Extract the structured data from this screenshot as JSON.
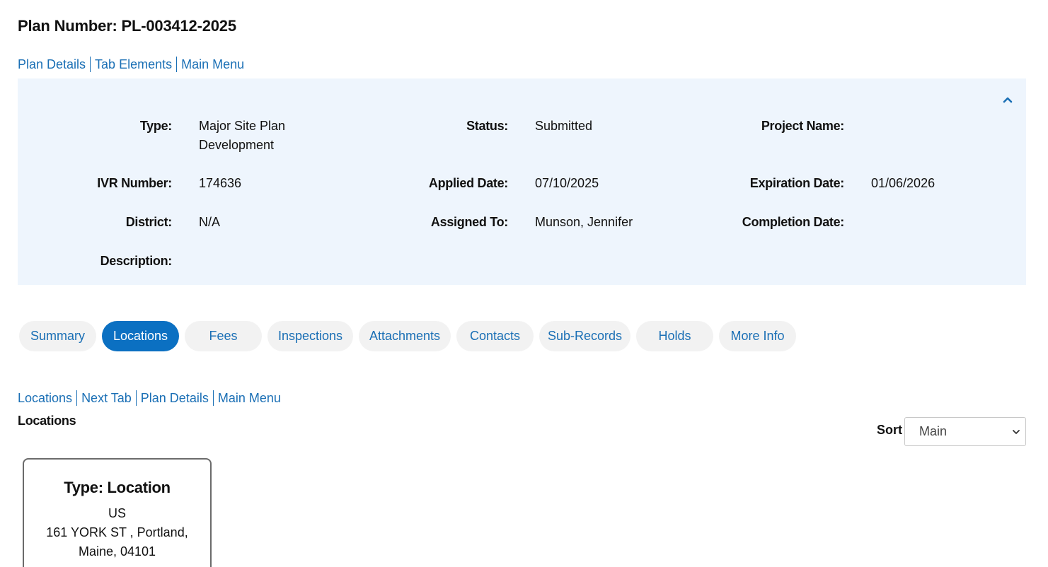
{
  "plan_title": "Plan Number: PL-003412-2025",
  "top_nav": [
    "Plan Details",
    "Tab Elements",
    "Main Menu"
  ],
  "details": {
    "type_label": "Type:",
    "type_value": [
      "Major Site Plan",
      "Development"
    ],
    "status_label": "Status:",
    "status_value": "Submitted",
    "project_name_label": "Project Name:",
    "project_name_value": "",
    "ivr_label": "IVR Number:",
    "ivr_value": "174636",
    "applied_label": "Applied Date:",
    "applied_value": "07/10/2025",
    "expiration_label": "Expiration Date:",
    "expiration_value": "01/06/2026",
    "district_label": "District:",
    "district_value": "N/A",
    "assigned_label": "Assigned To:",
    "assigned_value": "Munson, Jennifer",
    "completion_label": "Completion Date:",
    "completion_value": "",
    "description_label": "Description:",
    "description_value": "",
    "collapse_icon": "chevron-up-icon"
  },
  "tabs": [
    "Summary",
    "Locations",
    "Fees",
    "Inspections",
    "Attachments",
    "Contacts",
    "Sub-Records",
    "Holds",
    "More Info"
  ],
  "active_tab": "Locations",
  "section_nav": [
    "Locations",
    "Next Tab",
    "Plan Details",
    "Main Menu"
  ],
  "section_heading": "Locations",
  "sort": {
    "label": "Sort",
    "selected": "Main"
  },
  "location_card": {
    "title": "Type: Location",
    "country": "US",
    "address_line1": "161 YORK ST , Portland,",
    "address_line2": "Maine, 04101"
  },
  "colors": {
    "link": "#1a6fb5",
    "active_tab": "#0b70c2",
    "panel_bg": "#eef5fd",
    "tab_bg": "#f2f2f2"
  }
}
